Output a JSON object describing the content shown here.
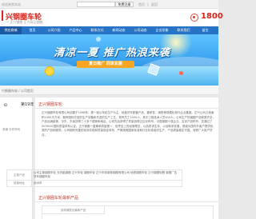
{
  "topbar": {
    "welcome": "欢迎来到本站",
    "search_button": "免费注册",
    "links": "首页  |  返回"
  },
  "header": {
    "brand": "兴钢圈车轮",
    "subtitle": "一 正兴钢圈 正兴高品钢圈",
    "phone": "1800"
  },
  "nav": {
    "items": [
      "供应商城",
      "首页",
      "公司介绍",
      "产品中心",
      "联系方式",
      "新闻动态",
      "公司动态",
      "企业形象",
      "联系我们",
      "留言"
    ]
  },
  "banner": {
    "title": "清凉一夏 推广热浪来袭",
    "ribbon": "夏日推广 同享实惠"
  },
  "breadcrumb": "兴钢圈车轮 / 公司首页",
  "sidebar": {
    "rank_label": "ID",
    "rank_value": "第19年",
    "contact": "商铺  手机号码"
  },
  "main": {
    "section_title": "正兴钢圈车轮",
    "intro": "正兴钢圈车轮有限公司创建于1996年，是一家以车轮生产为主，经营货车配套产品，集研发、销售等规模化现代企业集团。正兴公司占地面积1000平方米，拥有国际先进的生产设备和先进的生产工艺，现有员工2000人，其中工程技术人员400人。公司生产的钢圈产品种类齐全，产品远销欧美、中东、东南亚等三十多个国家和地区。公司先后获得了质量信得过企业称号、中国钢圈十强企业、名优产品称号，并通过了ISO9001国际质量体系认证。正兴钢圈一直秉承质量第一、信誉至上的经营理念，以品质求生存，以创新求发展，竭诚为国内外客户提供优质的产品和服务。公司拥有完善的检测手段和质量保证体系，严格按照国家标准和行业标准组织生产，产品质量稳定可靠，深受广大用户好评。",
    "table": [
      {
        "label": "主营产品",
        "value": "公司主营钢圈车轮 无内胎钢圈 正兴车轮 钢圈车轮 正兴车轮新款钢圈有限公司 地铁钢圈车轮 正兴钢圈轮毂 钢圈广告 货车钢圈车轮"
      },
      {
        "label": "经营地址",
        "value": "沧州市"
      }
    ],
    "products_title": "正兴钢圈车轮最新产品",
    "empty_cell": "该商铺暂无最新产品"
  }
}
